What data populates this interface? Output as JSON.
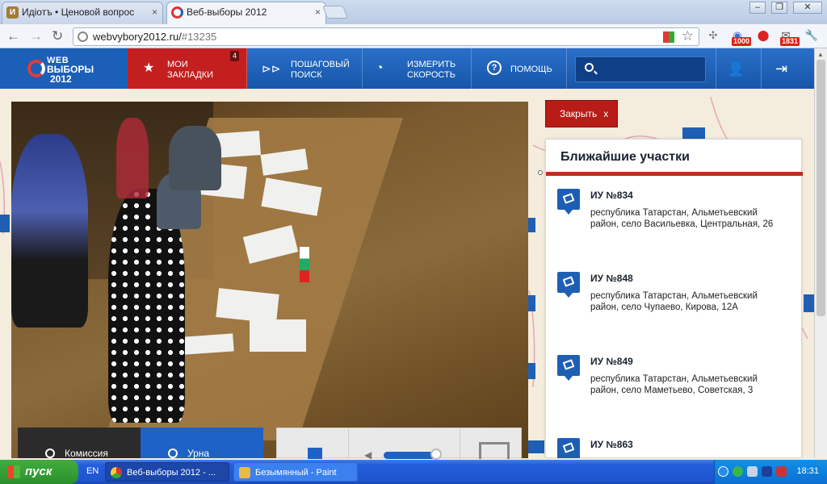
{
  "browser": {
    "tabs": [
      {
        "title": "Идіотъ • Ценовой вопрос",
        "favicon": "И",
        "active": false
      },
      {
        "title": "Веб-выборы 2012",
        "favicon": "",
        "active": true
      }
    ],
    "url_host": "webvybory2012.ru/",
    "url_path": "#13235",
    "ext_badges": [
      "1000",
      "1831"
    ]
  },
  "site": {
    "logo": {
      "line1": "WEB",
      "line2": "ВЫБОРЫ",
      "line3": "2012"
    },
    "nav": [
      {
        "label_line1": "МОИ",
        "label_line2": "ЗАКЛАДКИ",
        "badge": "4"
      },
      {
        "label_line1": "ПОШАГОВЫЙ",
        "label_line2": "ПОИСК"
      },
      {
        "label_line1": "ИЗМЕРИТЬ",
        "label_line2": "СКОРОСТЬ"
      },
      {
        "label_line1": "ПОМОЩЬ"
      }
    ],
    "search_placeholder": ""
  },
  "video_controls": {
    "left_label": "Комиссия",
    "right_label": "Урна"
  },
  "panel": {
    "close_label": "Закрыть",
    "close_x": "x",
    "title": "Ближайшие участки",
    "stations": [
      {
        "name": "ИУ №834",
        "address": "республика Татарстан, Альметьевский район, село Васильевка, Центральная, 26"
      },
      {
        "name": "ИУ №848",
        "address": "республика Татарстан, Альметьевский район, село Чупаево, Кирова, 12А"
      },
      {
        "name": "ИУ №849",
        "address": "республика Татарстан, Альметьевский район, село Маметьево, Советская, 3"
      },
      {
        "name": "ИУ №863",
        "address": ""
      }
    ]
  },
  "taskbar": {
    "start": "пуск",
    "lang": "EN",
    "tasks": [
      {
        "title": "Веб-выборы 2012 - ...",
        "active": true
      },
      {
        "title": "Безымянный - Paint",
        "active": false
      }
    ],
    "clock": "18:31"
  },
  "colors": {
    "header_blue": "#1a5eb5",
    "accent_red": "#c41f1f",
    "panel_line": "#b7321f",
    "taskbar": "#245edb"
  }
}
